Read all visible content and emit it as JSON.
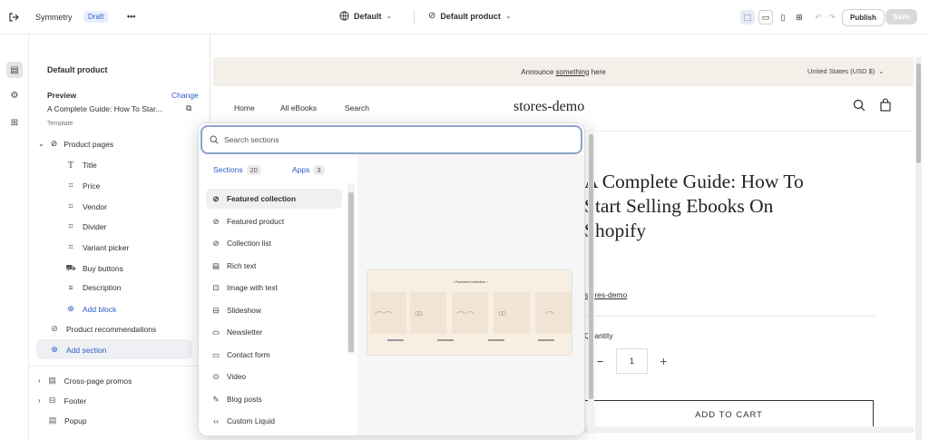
{
  "topbar": {
    "theme_name": "Symmetry",
    "status_badge": "Draft",
    "more_label": "•••",
    "template_selector": "Default",
    "product_selector": "Default product",
    "publish_label": "Publish",
    "save_label": "Save"
  },
  "sidebar": {
    "title": "Default product",
    "preview_label": "Preview",
    "change_link": "Change",
    "preview_value": "A Complete Guide: How To Star...",
    "template_label": "Template",
    "product_pages": "Product pages",
    "blocks": [
      {
        "label": "Title",
        "icon": "T"
      },
      {
        "label": "Price",
        "icon": "[ ]"
      },
      {
        "label": "Vendor",
        "icon": "[ ]"
      },
      {
        "label": "Divider",
        "icon": "[ ]"
      },
      {
        "label": "Variant picker",
        "icon": "[ ]"
      },
      {
        "label": "Buy buttons",
        "icon": "cart"
      },
      {
        "label": "Description",
        "icon": "lines"
      }
    ],
    "add_block": "Add block",
    "product_recommendations": "Product recommendations",
    "add_section": "Add section",
    "cross_page_promos": "Cross-page promos",
    "footer": "Footer",
    "popup": "Popup"
  },
  "store": {
    "announcement_prefix": "Announce ",
    "announcement_link": "something",
    "announcement_suffix": " here",
    "currency": "United States (USD $)",
    "nav": [
      "Home",
      "All eBooks",
      "Search"
    ],
    "logo": "stores-demo",
    "product_title_lines": [
      "A Complete Guide: How To",
      "Start Selling Ebooks On",
      "Shopify"
    ],
    "vendor": "stores-demo",
    "quantity_label": "Quantity",
    "quantity_value": "1",
    "add_to_cart": "ADD TO CART"
  },
  "picker": {
    "search_placeholder": "Search sections",
    "tab_sections": "Sections",
    "sections_count": "20",
    "tab_apps": "Apps",
    "apps_count": "3",
    "items": [
      "Featured collection",
      "Featured product",
      "Collection list",
      "Rich text",
      "Image with text",
      "Slideshow",
      "Newsletter",
      "Contact form",
      "Video",
      "Blog posts",
      "Custom Liquid"
    ],
    "preview_heading": "Featured collection"
  },
  "colors": {
    "accent": "#2c5cc5",
    "announce_bg": "#f3efe9",
    "draft_bg": "#e6efff"
  }
}
